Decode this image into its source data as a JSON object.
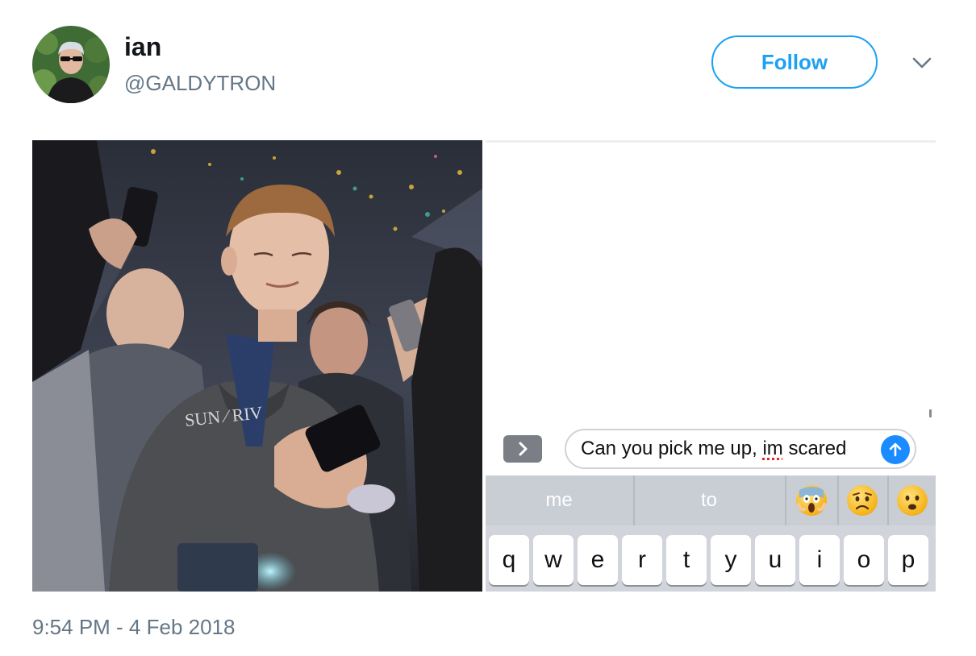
{
  "tweet": {
    "display_name": "ian",
    "handle": "@GALDYTRON",
    "follow_label": "Follow",
    "timestamp": "9:54 PM - 4 Feb 2018"
  },
  "media": {
    "photo_icon": "photo-crowd-phone",
    "imessage": {
      "app_drawer_icon": "chevron-right-icon",
      "compose_before": "Can you pick me up, ",
      "compose_misspelled": "im",
      "compose_after": " scared",
      "send_icon": "arrow-up-icon",
      "suggestions": [
        "me",
        "to"
      ],
      "emoji_suggestions": [
        "face-screaming-in-fear",
        "worried-face",
        "frowning-face"
      ],
      "keys": [
        "q",
        "w",
        "e",
        "r",
        "t",
        "y",
        "u",
        "i",
        "o",
        "p"
      ]
    }
  },
  "colors": {
    "brand": "#1da1f2",
    "muted_text": "#657786",
    "imessage_blue": "#1a8cff",
    "keyboard_bg": "#d1d5db"
  }
}
